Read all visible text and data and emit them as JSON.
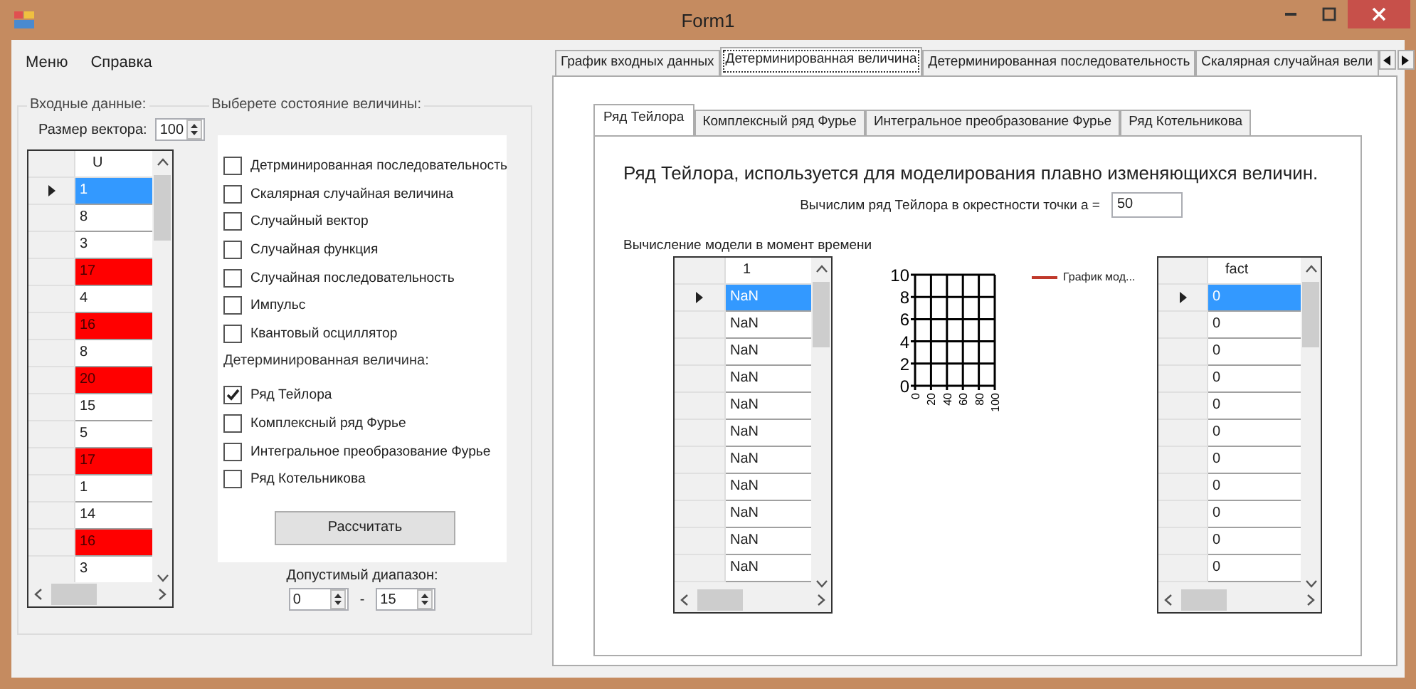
{
  "window": {
    "title": "Form1"
  },
  "menu": [
    "Меню",
    "Справка"
  ],
  "input_group": {
    "title": "Входные данные:",
    "vector_size_label": "Размер вектора:",
    "vector_size": "100",
    "grid": {
      "columns": [
        "U"
      ],
      "rows": [
        {
          "value": "1",
          "selected": true,
          "flagged": false
        },
        {
          "value": "8",
          "selected": false,
          "flagged": false
        },
        {
          "value": "3",
          "selected": false,
          "flagged": false
        },
        {
          "value": "17",
          "selected": false,
          "flagged": true
        },
        {
          "value": "4",
          "selected": false,
          "flagged": false
        },
        {
          "value": "16",
          "selected": false,
          "flagged": true
        },
        {
          "value": "8",
          "selected": false,
          "flagged": false
        },
        {
          "value": "20",
          "selected": false,
          "flagged": true
        },
        {
          "value": "15",
          "selected": false,
          "flagged": false
        },
        {
          "value": "5",
          "selected": false,
          "flagged": false
        },
        {
          "value": "17",
          "selected": false,
          "flagged": true
        },
        {
          "value": "1",
          "selected": false,
          "flagged": false
        },
        {
          "value": "14",
          "selected": false,
          "flagged": false
        },
        {
          "value": "16",
          "selected": false,
          "flagged": true
        },
        {
          "value": "3",
          "selected": false,
          "flagged": false
        }
      ]
    }
  },
  "state_group": {
    "title": "Выберете состояние величины:",
    "options": [
      {
        "label": "Детрминированная последовательность",
        "checked": false
      },
      {
        "label": "Скалярная случайная величина",
        "checked": false
      },
      {
        "label": "Случайный вектор",
        "checked": false
      },
      {
        "label": "Случайная функция",
        "checked": false
      },
      {
        "label": "Случайная последовательность",
        "checked": false
      },
      {
        "label": "Импульс",
        "checked": false
      },
      {
        "label": "Квантовый осциллятор",
        "checked": false
      }
    ],
    "subtitle": "Детерминированная величина:",
    "det_options": [
      {
        "label": "Ряд Тейлора",
        "checked": true
      },
      {
        "label": "Комплексный ряд Фурье",
        "checked": false
      },
      {
        "label": "Интегральное преобразование Фурье",
        "checked": false
      },
      {
        "label": "Ряд Котельникова",
        "checked": false
      }
    ],
    "button": "Рассчитать",
    "range_label": "Допустимый диапазон:",
    "range_from": "0",
    "range_separator": "-",
    "range_to": "15"
  },
  "tabs": [
    {
      "label": "График входных данных",
      "selected": false
    },
    {
      "label": "Детерминированная величина",
      "selected": true
    },
    {
      "label": "Детерминированная последовательность",
      "selected": false
    },
    {
      "label": "Скалярная случайная вели",
      "selected": false
    }
  ],
  "subtabs": [
    {
      "label": "Ряд Тейлора",
      "selected": true
    },
    {
      "label": "Комплексный ряд Фурье",
      "selected": false
    },
    {
      "label": "Интегральное преобразование Фурье",
      "selected": false
    },
    {
      "label": "Ряд Котельникова",
      "selected": false
    }
  ],
  "heading": "Ряд Тейлора, используется для моделирования плавно изменяющихся величин.",
  "point_label": "Вычислим ряд Тейлора в окрестности точки а =",
  "point_value": "50",
  "model_label": "Вычисление модели в момент времени",
  "model_grid": {
    "columns": [
      "1"
    ],
    "rows": [
      {
        "value": "NaN",
        "selected": true
      },
      {
        "value": "NaN",
        "selected": false
      },
      {
        "value": "NaN",
        "selected": false
      },
      {
        "value": "NaN",
        "selected": false
      },
      {
        "value": "NaN",
        "selected": false
      },
      {
        "value": "NaN",
        "selected": false
      },
      {
        "value": "NaN",
        "selected": false
      },
      {
        "value": "NaN",
        "selected": false
      },
      {
        "value": "NaN",
        "selected": false
      },
      {
        "value": "NaN",
        "selected": false
      },
      {
        "value": "NaN",
        "selected": false
      }
    ]
  },
  "chart": {
    "y_labels": [
      "10",
      "8",
      "6",
      "4",
      "2",
      "0"
    ],
    "x_labels": [
      "0",
      "20",
      "40",
      "60",
      "80",
      "100"
    ],
    "legend": "График мод..."
  },
  "fact_grid": {
    "columns": [
      "fact"
    ],
    "rows": [
      {
        "value": "0",
        "selected": true
      },
      {
        "value": "0",
        "selected": false
      },
      {
        "value": "0",
        "selected": false
      },
      {
        "value": "0",
        "selected": false
      },
      {
        "value": "0",
        "selected": false
      },
      {
        "value": "0",
        "selected": false
      },
      {
        "value": "0",
        "selected": false
      },
      {
        "value": "0",
        "selected": false
      },
      {
        "value": "0",
        "selected": false
      },
      {
        "value": "0",
        "selected": false
      },
      {
        "value": "0",
        "selected": false
      }
    ]
  }
}
